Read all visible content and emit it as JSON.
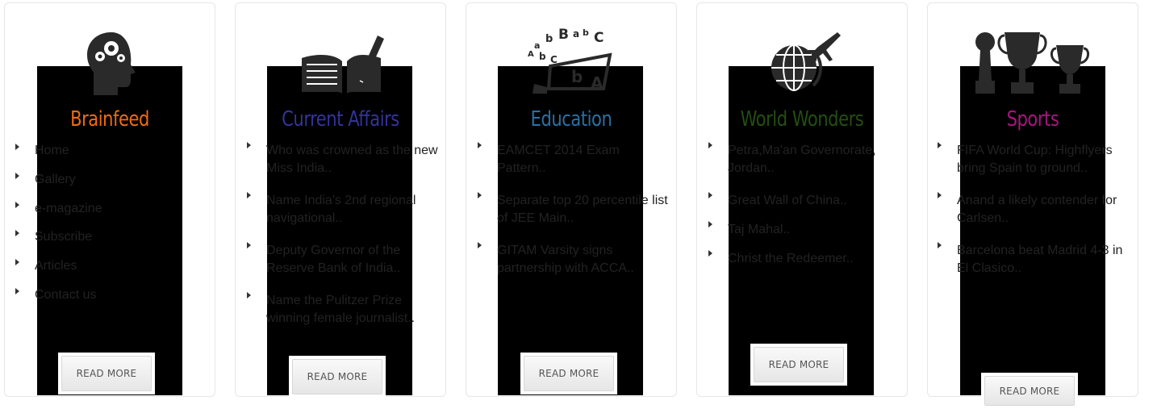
{
  "cards": [
    {
      "id": "brainfeed",
      "title": "Brainfeed",
      "title_color": "#ef6b10",
      "icon": "head-gears-icon",
      "items": [
        "Home",
        "Gallery",
        "e-magazine",
        "Subscribe",
        "Articles",
        "Contact us"
      ],
      "button": "READ MORE"
    },
    {
      "id": "current-affairs",
      "title": "Current Affairs",
      "title_color": "#33339a",
      "icon": "book-pen-icon",
      "items": [
        "Who was crowned as the new Miss India..",
        "Name India's 2nd regional navigational..",
        "Deputy Governor of the Reserve Bank of India..",
        "Name the Pulitzer Prize winning female journalist.."
      ],
      "button": "READ MORE"
    },
    {
      "id": "education",
      "title": "Education",
      "title_color": "#2a6fa2",
      "icon": "laptop-letters-icon",
      "items": [
        "EAMCET 2014 Exam Pattern..",
        "Separate top 20 percentile list of JEE Main..",
        "GITAM Varsity signs partnership with ACCA.."
      ],
      "button": "READ MORE"
    },
    {
      "id": "world-wonders",
      "title": "World Wonders",
      "title_color": "#244e12",
      "icon": "globe-plane-icon",
      "items": [
        "Petra,Ma'an Governorate, Jordan..",
        "Great Wall of China..",
        "Taj Mahal..",
        "Christ the Redeemer.."
      ],
      "button": "READ MORE"
    },
    {
      "id": "sports",
      "title": "Sports",
      "title_color": "#a8157a",
      "icon": "trophies-icon",
      "items": [
        "FIFA World Cup: Highflyers bring Spain to ground..",
        "Anand a likely contender for Carlsen..",
        "Barcelona beat Madrid 4-3 in El Clasico.."
      ],
      "button": "READ MORE"
    }
  ]
}
